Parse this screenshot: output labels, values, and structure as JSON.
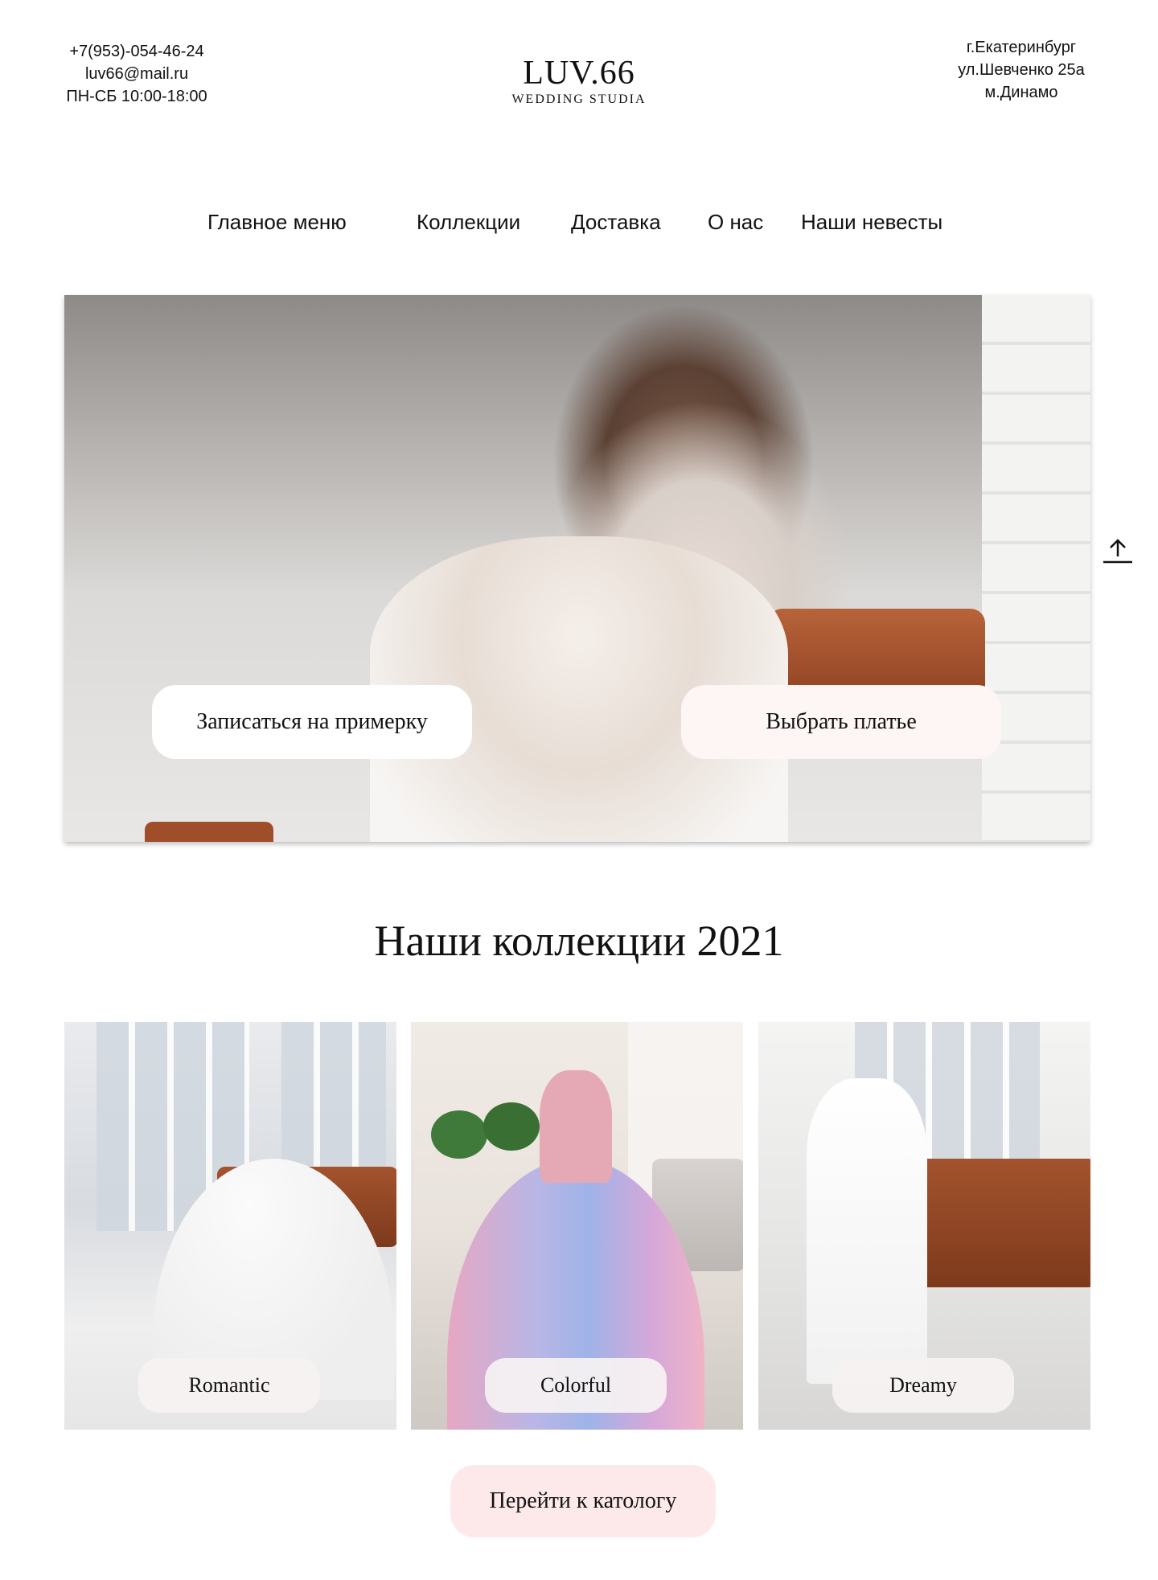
{
  "header": {
    "phone": "+7(953)-054-46-24",
    "email": "luv66@mail.ru",
    "hours": "ПН-СБ 10:00-18:00",
    "logo_title": "LUV.66",
    "logo_subtitle": "WEDDING STUDIA",
    "city": "г.Екатеринбург",
    "street": "ул.Шевченко 25а",
    "metro": "м.Динамо"
  },
  "nav": {
    "items": [
      "Главное меню",
      "Коллекции",
      "Доставка",
      "О нас",
      "Наши невесты"
    ]
  },
  "hero": {
    "fitting_button": "Записаться на примерку",
    "choose_button": "Выбрать платье"
  },
  "collections": {
    "title": "Наши коллекции 2021",
    "items": [
      "Romantic",
      "Colorful",
      "Dreamy"
    ],
    "catalog_button": "Перейти к катологу"
  },
  "icons": {
    "scroll_top": "arrow-up-icon"
  }
}
